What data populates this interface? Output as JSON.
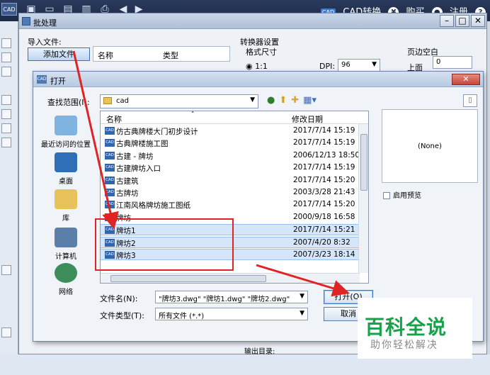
{
  "app": {
    "logo": "CAD",
    "toolbar_icons": [
      "new-icon",
      "open-icon",
      "save-icon",
      "save-as-icon",
      "print-icon",
      "undo-icon",
      "redo-icon"
    ],
    "right": {
      "cad_convert": "CAD转换",
      "buy": "购买",
      "register": "注册"
    }
  },
  "batch_window": {
    "title": "批处理",
    "import_label": "导入文件:",
    "add_file_button": "添加文件",
    "col_name": "名称",
    "col_type": "类型",
    "converter_settings": "转换器设置",
    "format_size": "格式尺寸",
    "ratio": "1:1",
    "dpi_label": "DPI:",
    "dpi_value": "96",
    "margin_label": "页边空白",
    "top_label": "上面",
    "top_value": "0",
    "output_dir_label": "输出目录:"
  },
  "open_dialog": {
    "title": "打开",
    "lookin_label": "查找范围(I):",
    "lookin_value": "cad",
    "places": [
      {
        "label": "最近访问的位置",
        "icon": "recent-places-icon"
      },
      {
        "label": "桌面",
        "icon": "desktop-icon"
      },
      {
        "label": "库",
        "icon": "libraries-icon"
      },
      {
        "label": "计算机",
        "icon": "computer-icon"
      },
      {
        "label": "网络",
        "icon": "network-icon"
      }
    ],
    "col_name": "名称",
    "col_modified": "修改日期",
    "files": [
      {
        "name": "仿古典牌楼大门初步设计",
        "date": "2017/7/14 15:19"
      },
      {
        "name": "古典牌楼施工图",
        "date": "2017/7/14 15:19"
      },
      {
        "name": "古建 - 牌坊",
        "date": "2006/12/13 18:50"
      },
      {
        "name": "古建牌坊入口",
        "date": "2017/7/14 15:19"
      },
      {
        "name": "古建筑",
        "date": "2017/7/14 15:20"
      },
      {
        "name": "古牌坊",
        "date": "2003/3/28 21:43"
      },
      {
        "name": "江南风格牌坊施工图纸",
        "date": "2017/7/14 15:20"
      },
      {
        "name": "牌坊",
        "date": "2000/9/18 16:58"
      },
      {
        "name": "牌坊1",
        "date": "2017/7/14 15:21"
      },
      {
        "name": "牌坊2",
        "date": "2007/4/20 8:32"
      },
      {
        "name": "牌坊3",
        "date": "2007/3/23 18:14"
      }
    ],
    "preview_text": "(None)",
    "enable_preview": "启用预览",
    "filename_label": "文件名(N):",
    "filename_value": "\"牌坊3.dwg\" \"牌坊1.dwg\" \"牌坊2.dwg\"",
    "filetype_label": "文件类型(T):",
    "filetype_value": "所有文件 (*.*)",
    "open_button": "打开(O)",
    "cancel_button": "取消"
  },
  "watermark": {
    "big": "百科全说",
    "small": "助你轻松解决"
  },
  "colors": {
    "annotation": "#e02424",
    "selection": "#d5e6fb",
    "watermark_green": "#15a24a"
  }
}
